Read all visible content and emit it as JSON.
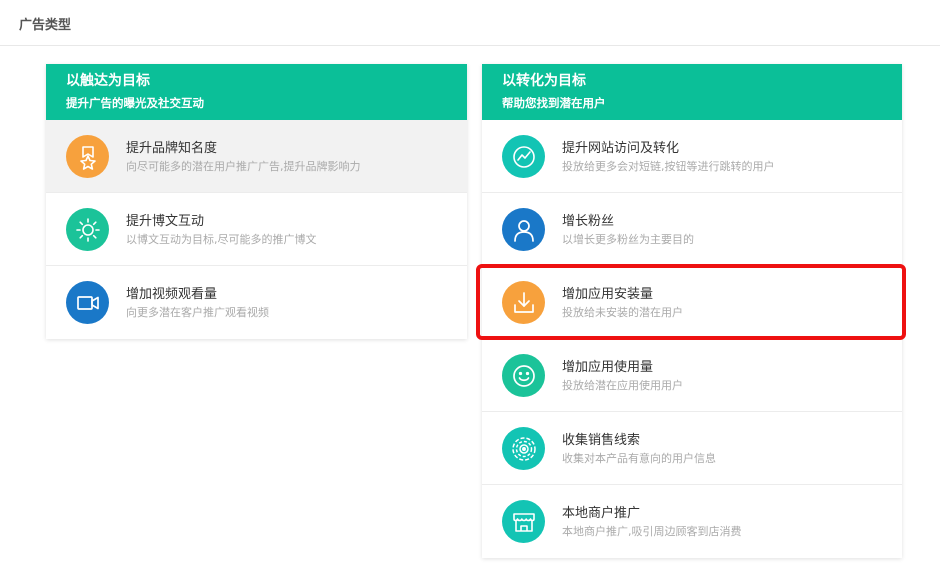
{
  "page": {
    "title": "广告类型"
  },
  "colors": {
    "accent": "#0bbf98",
    "orange": "#f7a13d",
    "teal": "#13c4b4",
    "blue": "#1a78c8",
    "green": "#1bc399",
    "highlight": "#ee1111",
    "selected_bg": "#f2f2f2"
  },
  "left": {
    "title": "以触达为目标",
    "subtitle": "提升广告的曝光及社交互动",
    "items": [
      {
        "title": "提升品牌知名度",
        "desc": "向尽可能多的潜在用户推广广告,提升品牌影响力",
        "icon": "badge-star-icon",
        "color": "orange"
      },
      {
        "title": "提升博文互动",
        "desc": "以博文互动为目标,尽可能多的推广博文",
        "icon": "sun-icon",
        "color": "green"
      },
      {
        "title": "增加视频观看量",
        "desc": "向更多潜在客户推广观看视频",
        "icon": "video-camera-icon",
        "color": "blue"
      }
    ]
  },
  "right": {
    "title": "以转化为目标",
    "subtitle": "帮助您找到潜在用户",
    "items": [
      {
        "title": "提升网站访问及转化",
        "desc": "投放给更多会对短链,按钮等进行跳转的用户",
        "icon": "trend-chart-icon",
        "color": "teal"
      },
      {
        "title": "增长粉丝",
        "desc": "以增长更多粉丝为主要目的",
        "icon": "user-icon",
        "color": "blue"
      },
      {
        "title": "增加应用安装量",
        "desc": "投放给未安装的潜在用户",
        "icon": "download-icon",
        "color": "orange"
      },
      {
        "title": "增加应用使用量",
        "desc": "投放给潜在应用使用用户",
        "icon": "smiley-icon",
        "color": "green"
      },
      {
        "title": "收集销售线索",
        "desc": "收集对本产品有意向的用户信息",
        "icon": "target-rings-icon",
        "color": "teal"
      },
      {
        "title": "本地商户推广",
        "desc": "本地商户推广,吸引周边顾客到店消费",
        "icon": "storefront-icon",
        "color": "teal"
      }
    ]
  }
}
